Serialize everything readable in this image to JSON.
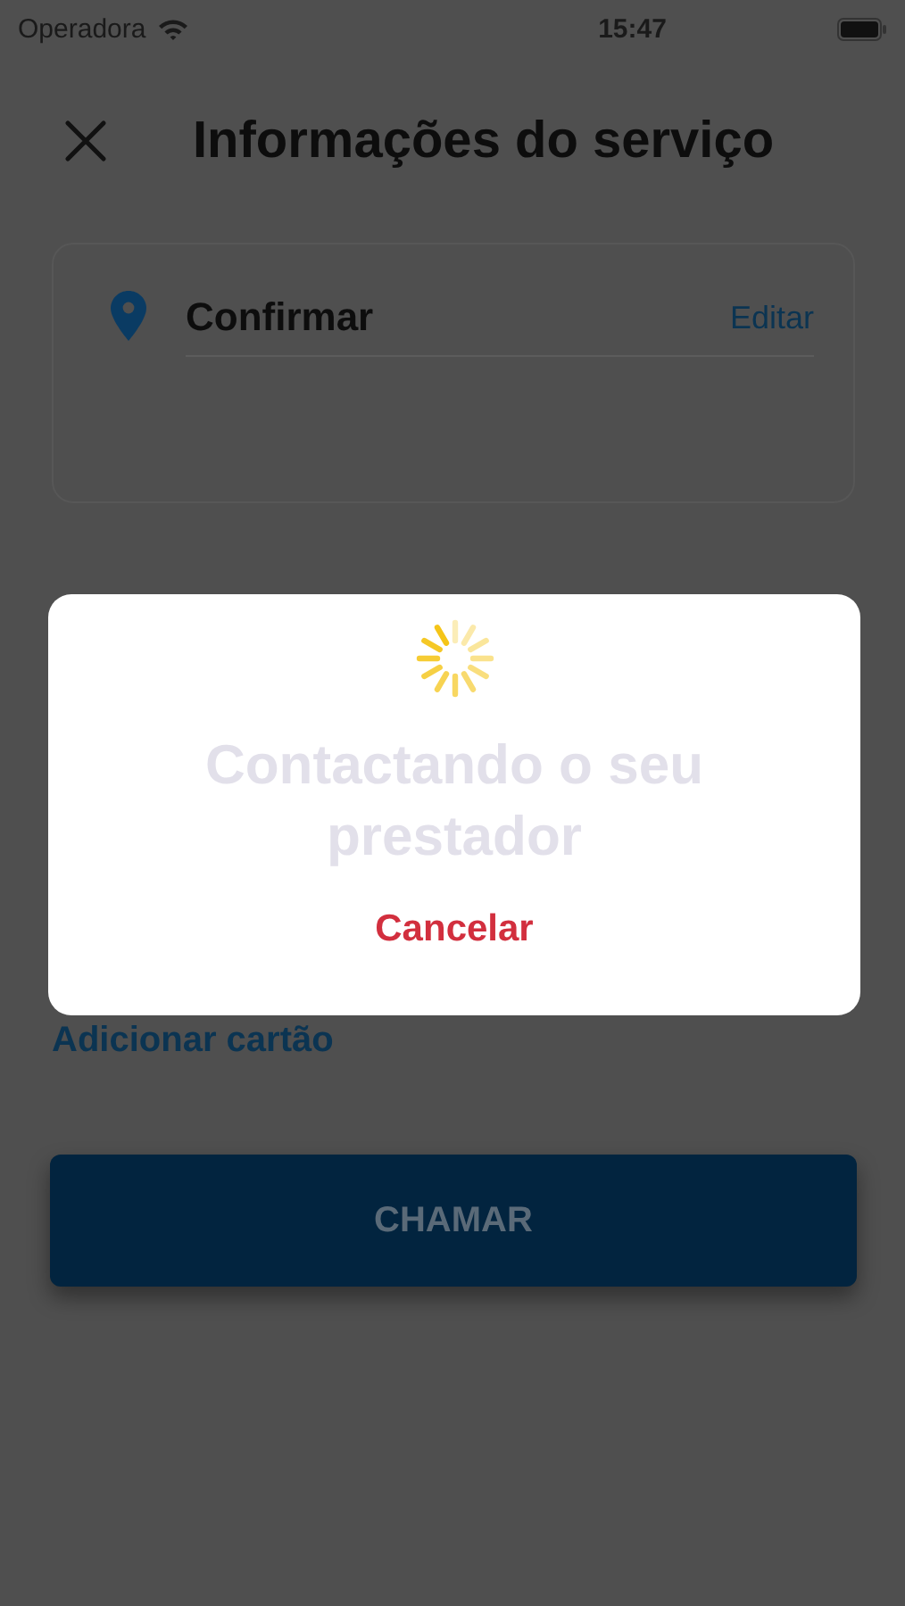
{
  "status_bar": {
    "carrier": "Operadora",
    "time": "15:47"
  },
  "header": {
    "title": "Informações do serviço"
  },
  "address_card": {
    "label": "Confirmar",
    "action": "Editar"
  },
  "add_card_link": "Adicionar cartão",
  "primary_button": {
    "label": "CHAMAR",
    "disabled": true
  },
  "dialog": {
    "message": "Contactando o seu prestador",
    "cancel": "Cancelar"
  }
}
